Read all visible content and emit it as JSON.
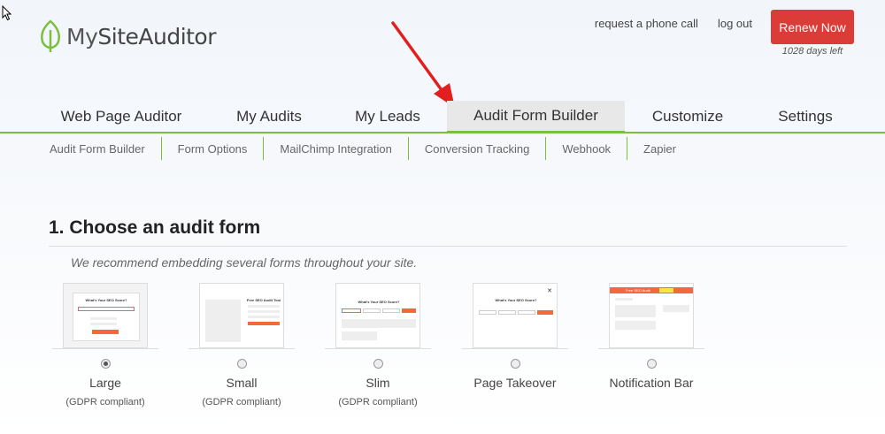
{
  "brand": {
    "name_prefix": "My",
    "name_rest": "SiteAuditor",
    "accent": "#7cbf3f",
    "renew_color": "#dc3c37"
  },
  "header": {
    "links": [
      "request a phone call",
      "log out"
    ],
    "renew_label": "Renew Now",
    "days_left": "1028 days left"
  },
  "main_nav": {
    "tabs": [
      "Web Page Auditor",
      "My Audits",
      "My Leads",
      "Audit Form Builder",
      "Customize",
      "Settings"
    ],
    "active": "Audit Form Builder"
  },
  "sub_nav": {
    "items": [
      "Audit Form Builder",
      "Form Options",
      "MailChimp Integration",
      "Conversion Tracking",
      "Webhook",
      "Zapier"
    ]
  },
  "content": {
    "title": "1. Choose an audit form",
    "recommend": "We recommend embedding several forms throughout your site."
  },
  "forms": [
    {
      "label": "Large",
      "note": "(GDPR compliant)",
      "selected": true,
      "thumb_heading": "What's Your SEO Score?"
    },
    {
      "label": "Small",
      "note": "(GDPR compliant)",
      "selected": false,
      "thumb_heading": "Free SEO Audit Tool"
    },
    {
      "label": "Slim",
      "note": "(GDPR compliant)",
      "selected": false,
      "thumb_heading": "What's Your SEO Score?"
    },
    {
      "label": "Page Takeover",
      "note": "",
      "selected": false,
      "thumb_heading": "What's Your SEO Score?"
    },
    {
      "label": "Notification Bar",
      "note": "",
      "selected": false,
      "thumb_heading": "Free SEO Audit"
    }
  ]
}
